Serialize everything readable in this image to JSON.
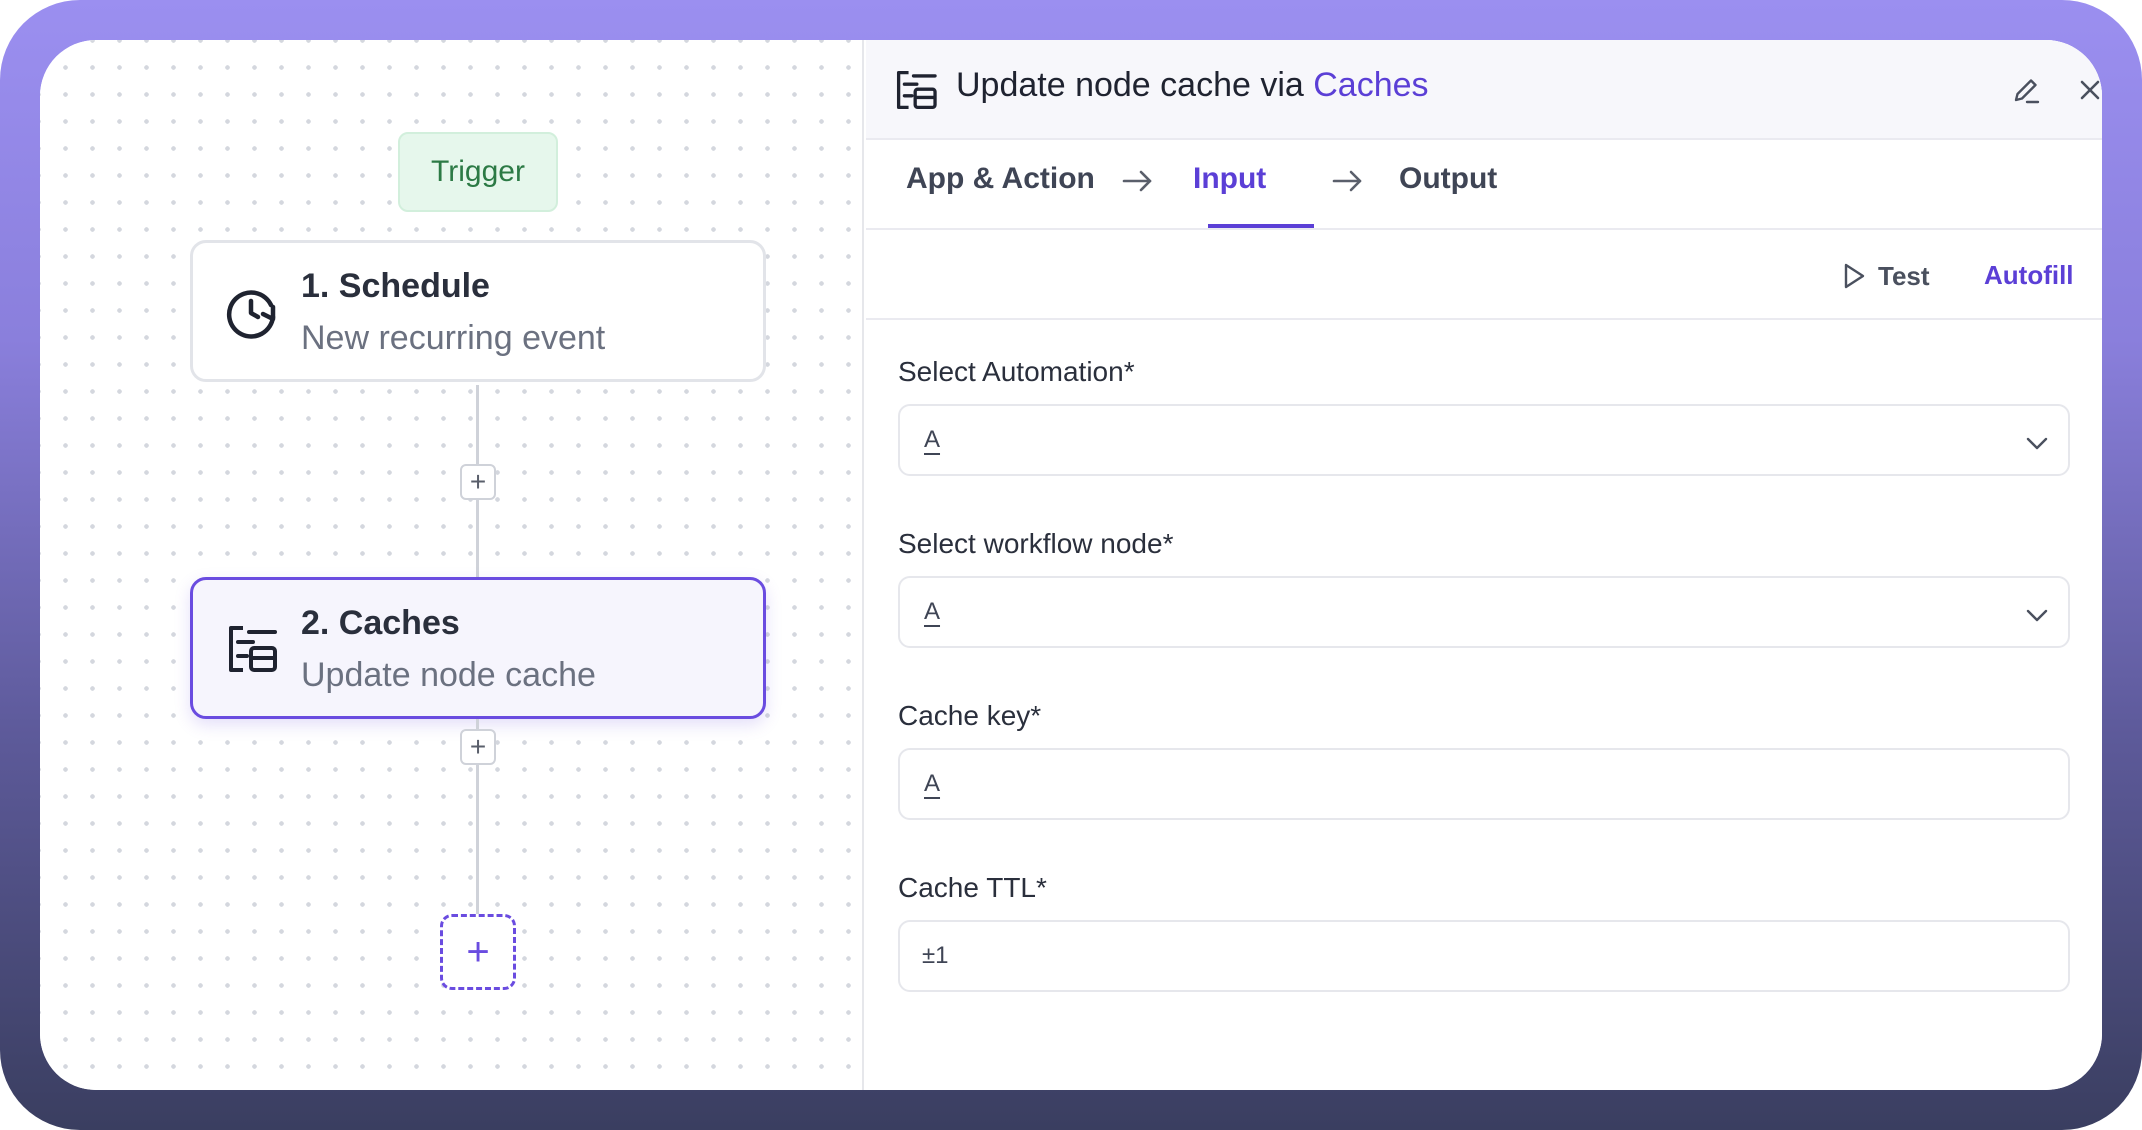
{
  "canvas": {
    "trigger_label": "Trigger",
    "nodes": [
      {
        "title": "1. Schedule",
        "subtitle": "New recurring event",
        "icon": "clock-refresh-icon"
      },
      {
        "title": "2. Caches",
        "subtitle": "Update node cache",
        "icon": "cache-icon"
      }
    ],
    "add_step_symbol": "+"
  },
  "panel": {
    "title_prefix": "Update node cache via ",
    "title_app": "Caches",
    "tabs": [
      {
        "label": "App & Action"
      },
      {
        "label": "Input"
      },
      {
        "label": "Output"
      }
    ],
    "active_tab": "Input",
    "test_label": "Test",
    "autofill_label": "Autofill",
    "fields": [
      {
        "label": "Select Automation*",
        "type_glyph": "A",
        "kind": "select"
      },
      {
        "label": "Select workflow node*",
        "type_glyph": "A",
        "kind": "select"
      },
      {
        "label": "Cache key*",
        "type_glyph": "A",
        "kind": "text"
      },
      {
        "label": "Cache TTL*",
        "type_glyph": "±1",
        "kind": "number"
      }
    ]
  },
  "colors": {
    "accent": "#5b3fd6",
    "trigger_green": "#2c7a45",
    "frame_top": "#9b8ff0",
    "frame_bottom": "#3a3e60"
  }
}
